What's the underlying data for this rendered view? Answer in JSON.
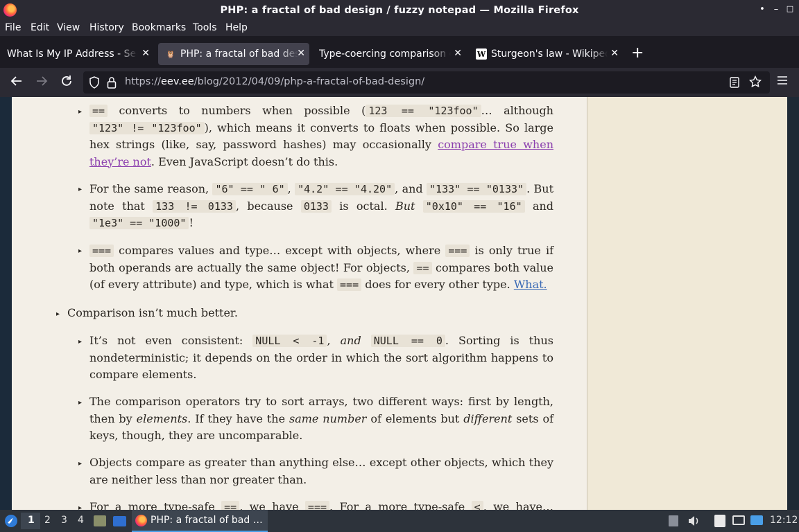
{
  "window": {
    "title": "PHP: a fractal of bad design / fuzzy notepad — Mozilla Firefox",
    "controls": [
      "•",
      "–",
      "□",
      "✕"
    ]
  },
  "menu": [
    "File",
    "Edit",
    "View",
    "History",
    "Bookmarks",
    "Tools",
    "Help"
  ],
  "tabs": [
    {
      "label": "What Is My IP Address - See",
      "icon": "none"
    },
    {
      "label": "PHP: a fractal of bad design",
      "icon": "owl-icon"
    },
    {
      "label": "Type-coercing comparison o",
      "icon": "none"
    },
    {
      "label": "Sturgeon's law - Wikipedia",
      "icon": "wikipedia-icon"
    }
  ],
  "newtab_label": "+",
  "url": {
    "prefix": "https://",
    "host": "eev.ee",
    "path": "/blog/2012/04/09/php-a-fractal-of-bad-design/"
  },
  "article": {
    "b1": {
      "c1": "==",
      "t1": " converts to numbers when possible (",
      "c2": "123 == \"123foo\"",
      "t2": "… although ",
      "c3": "\"123\" != \"123foo\"",
      "t3": "), which means it converts to floats when possible. So large hex strings (like, say, password hashes) may occasionally ",
      "link": "compare true when they’re not",
      "t4": ". Even JavaScript doesn’t do this."
    },
    "b2": {
      "t1": "For the same reason, ",
      "c1": "\"6\" == \" 6\"",
      "t2": ", ",
      "c2": "\"4.2\" == \"4.20\"",
      "t3": ", and ",
      "c3": "\"133\" == \"0133\"",
      "t4": ". But note that ",
      "c4": "133 != 0133",
      "t5": ", because ",
      "c5": "0133",
      "t6": " is octal. ",
      "em": "But",
      "t7": " ",
      "c6": "\"0x10\" == \"16\"",
      "t8": " and ",
      "c7": "\"1e3\" == \"1000\"",
      "t9": "!"
    },
    "b3": {
      "c1": "===",
      "t1": " compares values and type… except with objects, where ",
      "c2": "===",
      "t2": " is only true if both operands are actually the same object! For objects, ",
      "c3": "==",
      "t3": " compares both value (of every attribute) and type, which is what ",
      "c4": "===",
      "t4": " does for every other type. ",
      "link": "What."
    },
    "h1": "Comparison isn’t much better.",
    "b4": {
      "t1": "It’s not even consistent: ",
      "c1": "NULL < -1",
      "t2": ", ",
      "em": "and",
      "t3": " ",
      "c2": "NULL == 0",
      "t4": ". Sorting is thus nondeterministic; it depends on the order in which the sort algorithm happens to compare elements."
    },
    "b5": {
      "t1": "The comparison operators try to sort arrays, two different ways: first by length, then by ",
      "em1": "elements",
      "t2": ". If they have the ",
      "em2": "same number",
      "t3": " of elements but ",
      "em3": "different",
      "t4": " sets of keys, though, they are uncomparable."
    },
    "b6": "Objects compare as greater than anything else… except other objects, which they are neither less than nor greater than.",
    "b7": {
      "t1": "For a more type-safe ",
      "c1": "==",
      "t2": ", we have ",
      "c2": "===",
      "t3": ". For a more type-safe ",
      "c3": "<",
      "t4": ", we have… nothing."
    }
  },
  "taskbar": {
    "workspaces": [
      "1",
      "2",
      "3",
      "4"
    ],
    "task_title": "PHP: a fractal of bad …",
    "clock": "12:12"
  }
}
